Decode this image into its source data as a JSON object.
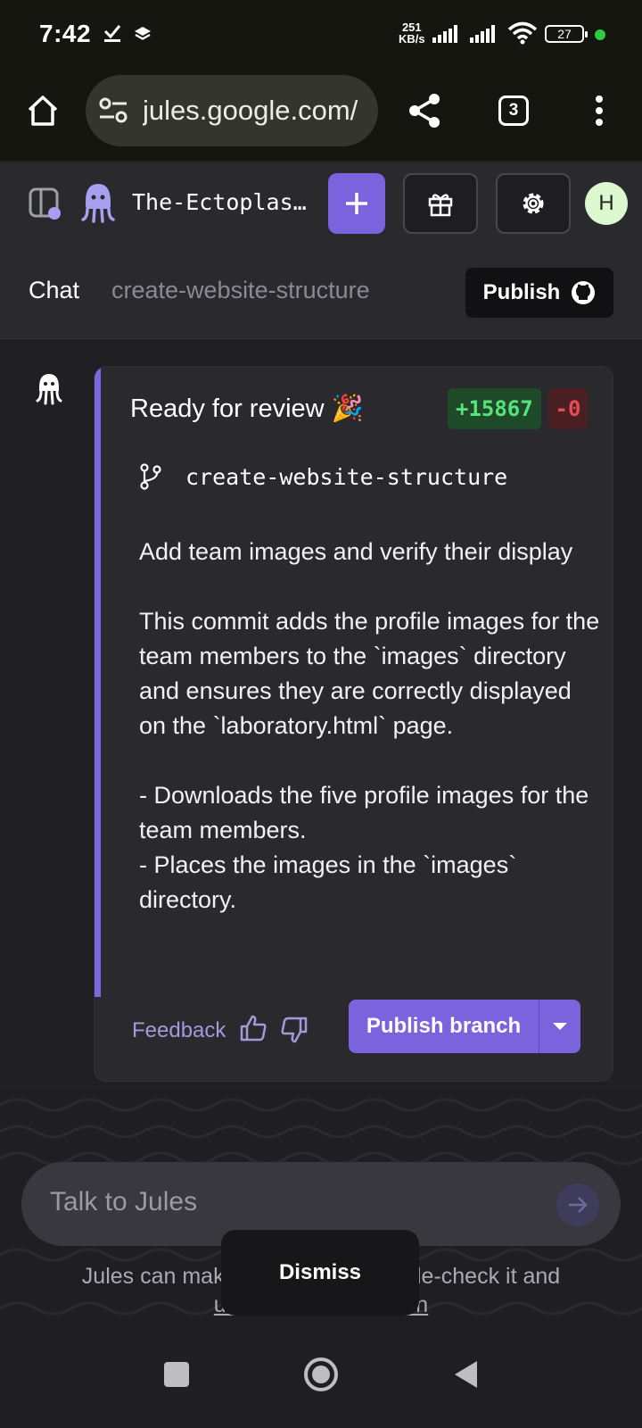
{
  "status_bar": {
    "time": "7:42",
    "net_speed_value": "251",
    "net_speed_unit": "KB/s",
    "battery": "27"
  },
  "browser": {
    "url": "jules.google.com/",
    "tab_count": "3"
  },
  "app_header": {
    "repo_name": "The-Ectoplas…",
    "avatar_initial": "H"
  },
  "sub_header": {
    "chat_tab": "Chat",
    "branch_tab": "create-website-structure",
    "publish_label": "Publish"
  },
  "message": {
    "title": "Ready for review 🎉",
    "additions": "+15867",
    "deletions": "-0",
    "branch": "create-website-structure",
    "body": "Add team images and verify their display\n\nThis commit adds the profile images for the team members to the `images` directory and ensures they are correctly displayed on the `laboratory.html` page.\n\n- Downloads the five profile images for the team members.\n- Places the images in the `images` directory.",
    "feedback_label": "Feedback",
    "publish_branch_label": "Publish branch"
  },
  "composer": {
    "placeholder": "Talk to Jules",
    "disclaimer_line1": "Jules can make mistakes so double-check it and",
    "disclaimer_line2": "use code with caution"
  },
  "toast": {
    "dismiss_label": "Dismiss"
  },
  "colors": {
    "accent": "#7a63dd",
    "card_bar": "#7b68e0",
    "additions": "#58e27a",
    "deletions": "#e84b51",
    "avatar_bg": "#ddf7cf"
  }
}
